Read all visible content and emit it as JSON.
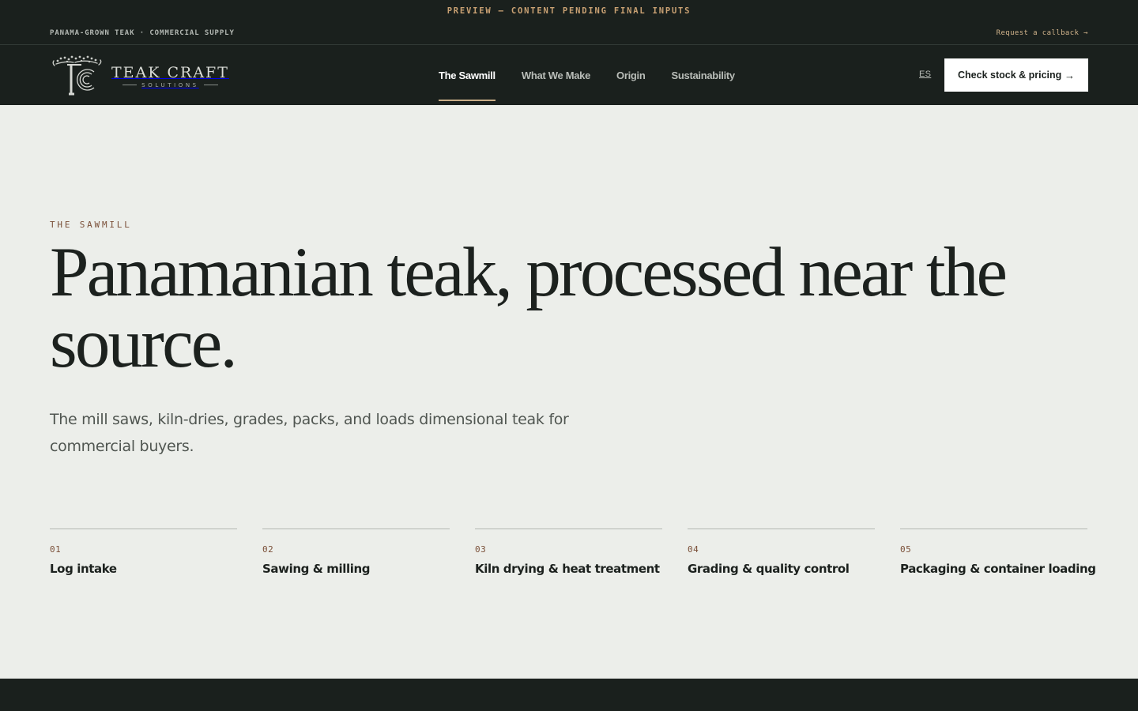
{
  "preview_banner": "PREVIEW — CONTENT PENDING FINAL INPUTS",
  "utility_bar": {
    "tagline": "PANAMA-GROWN TEAK · COMMERCIAL SUPPLY",
    "callback_link": "Request a callback →"
  },
  "logo": {
    "name": "TEAK CRAFT",
    "sub": "SOLUTIONS",
    "icon": "tree-roundel-icon"
  },
  "nav": {
    "items": [
      {
        "label": "The Sawmill",
        "active": true
      },
      {
        "label": "What We Make",
        "active": false
      },
      {
        "label": "Origin",
        "active": false
      },
      {
        "label": "Sustainability",
        "active": false
      }
    ],
    "lang": "ES",
    "cta": {
      "label": "Check stock & pricing",
      "arrow": "→"
    }
  },
  "hero": {
    "eyebrow": "THE SAWMILL",
    "title": "Panamanian teak, processed near the source.",
    "lede": "The mill saws, kiln-dries, grades, packs, and loads dimensional teak for commercial buyers."
  },
  "steps": [
    {
      "num": "01",
      "title": "Log intake"
    },
    {
      "num": "02",
      "title": "Sawing & milling"
    },
    {
      "num": "03",
      "title": "Kiln drying & heat treatment"
    },
    {
      "num": "04",
      "title": "Grading & quality control"
    },
    {
      "num": "05",
      "title": "Packaging & container loading"
    }
  ],
  "colors": {
    "dark": "#1a201d",
    "page_bg": "#eceeea",
    "accent_copper": "#7a4f38",
    "accent_tan": "#c9a173"
  }
}
